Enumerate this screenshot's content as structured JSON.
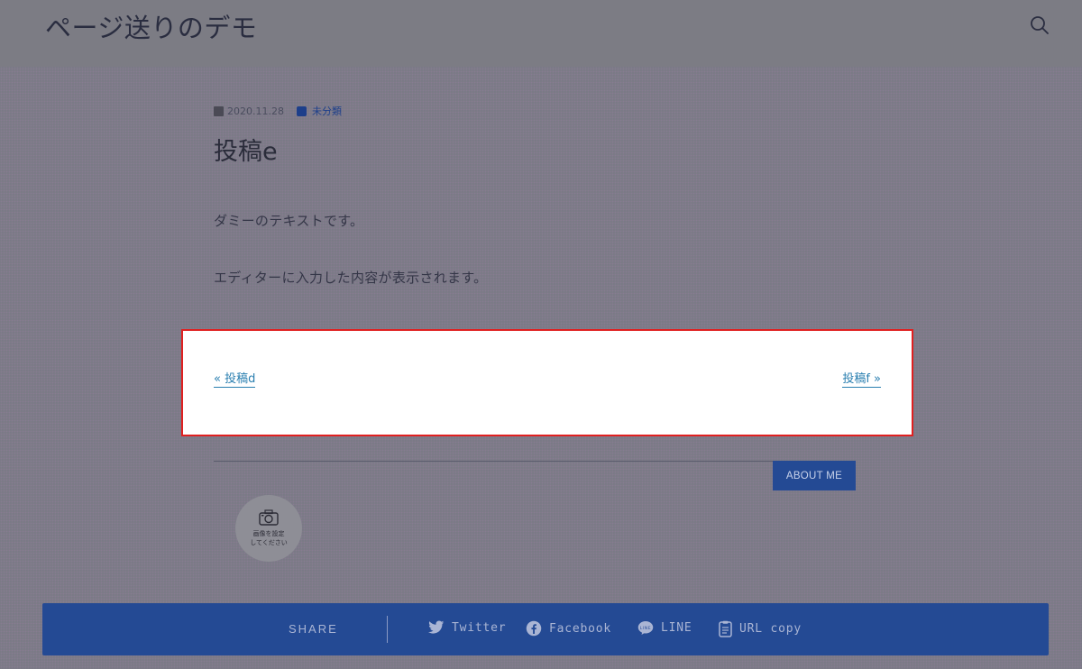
{
  "header": {
    "site_title": "ページ送りのデモ",
    "search_icon": "search-icon"
  },
  "post": {
    "date": "2020.11.28",
    "category": "未分類",
    "title": "投稿e",
    "paragraphs": [
      "ダミーのテキストです。",
      "エディターに入力した内容が表示されます。"
    ]
  },
  "post_nav": {
    "prev_label": "« 投稿d",
    "next_label": "投稿f »",
    "link_color": "#2a7fb0",
    "highlight_border": "#e02020"
  },
  "author": {
    "about_label": "ABOUT ME",
    "avatar_text_line1": "画像を設定",
    "avatar_text_line2": "してください"
  },
  "share": {
    "label": "SHARE",
    "items": [
      {
        "label": "Twitter",
        "icon": "twitter-icon"
      },
      {
        "label": "Facebook",
        "icon": "facebook-icon"
      },
      {
        "label": "LINE",
        "icon": "line-icon"
      },
      {
        "label": "URL copy",
        "icon": "clipboard-icon"
      }
    ],
    "bar_color": "#244a94"
  }
}
